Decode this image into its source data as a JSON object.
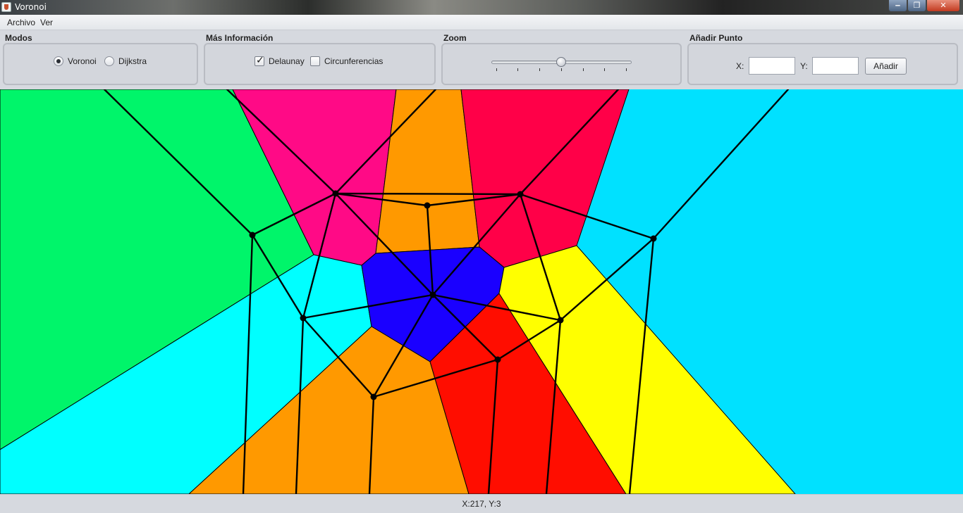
{
  "window": {
    "title": "Voronoi",
    "controls": {
      "minimize": "‒",
      "maximize": "❐",
      "close": "✕"
    }
  },
  "menubar": {
    "items": [
      "Archivo",
      "Ver"
    ]
  },
  "panels": {
    "modos": {
      "title": "Modos",
      "options": [
        "Voronoi",
        "Dijkstra"
      ],
      "selected": "Voronoi"
    },
    "mas_informacion": {
      "title": "Más Información",
      "checkboxes": [
        {
          "label": "Delaunay",
          "checked": true,
          "mark": "✓"
        },
        {
          "label": "Circunferencias",
          "checked": false,
          "mark": ""
        }
      ]
    },
    "zoom": {
      "title": "Zoom",
      "ticks": 7,
      "level": 0.5
    },
    "anadir_punto": {
      "title": "Añadir Punto",
      "x_label": "X:",
      "y_label": "Y:",
      "x_value": "",
      "y_value": "",
      "button": "Añadir"
    }
  },
  "canvas": {
    "colors": {
      "background": "#00e1ff",
      "green": "#00f56a",
      "magenta": "#ff0a86",
      "orange": "#ff9900",
      "crimson": "#ff0048",
      "cyan": "#00ffff",
      "blue": "#1a00ff",
      "red": "#ff0d00",
      "yellow": "#ffff00",
      "lines": "#000000"
    }
  },
  "status": {
    "coords": "X:217, Y:3"
  }
}
